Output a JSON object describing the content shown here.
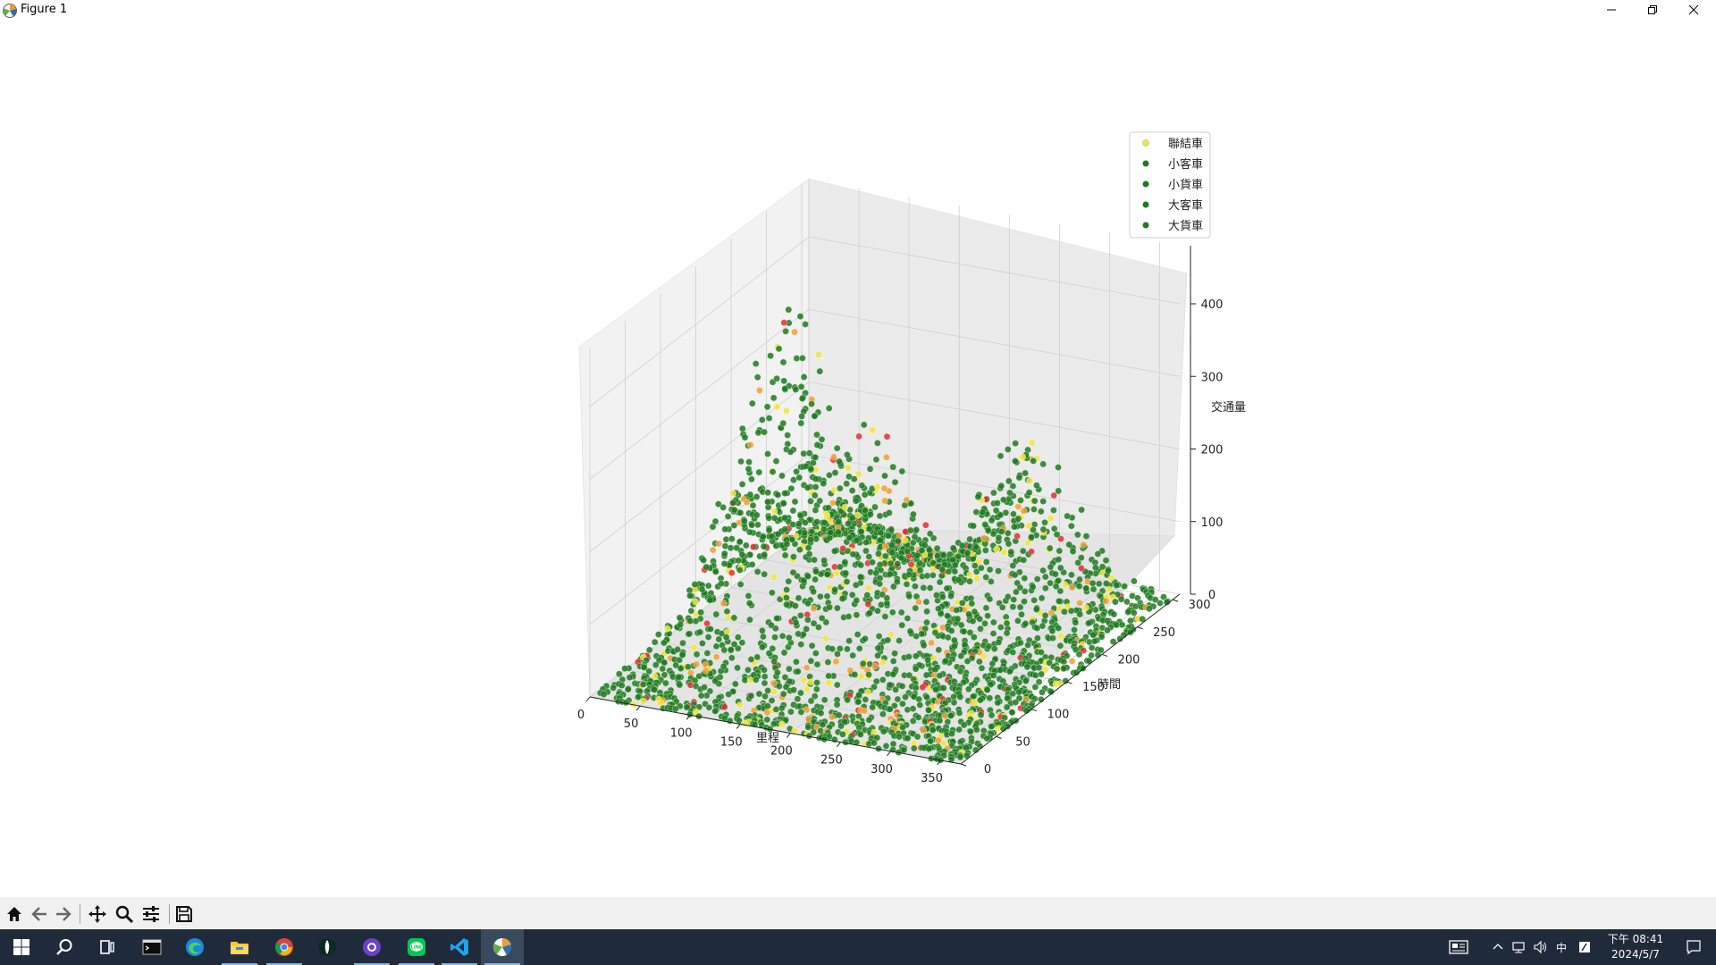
{
  "window": {
    "title": "Figure 1",
    "icons": {
      "app": "matplotlib-icon",
      "minimize": "minimize-icon",
      "restore": "restore-icon",
      "close": "close-icon"
    }
  },
  "chart_data": {
    "type": "scatter",
    "projection": "3d",
    "xlabel": "里程",
    "ylabel": "時間",
    "zlabel": "交通量",
    "xticks": [
      "0",
      "50",
      "100",
      "150",
      "200",
      "250",
      "300",
      "350"
    ],
    "yticks": [
      "0",
      "50",
      "100",
      "150",
      "200",
      "250",
      "300"
    ],
    "zticks": [
      "0",
      "100",
      "200",
      "300",
      "400"
    ],
    "xlim": [
      0,
      370
    ],
    "ylim": [
      0,
      310
    ],
    "zlim": [
      0,
      480
    ],
    "grid": true,
    "legend_position": "top-right",
    "series": [
      {
        "name": "聯結車",
        "color": "#f3e53a"
      },
      {
        "name": "小客車",
        "color": "#1f7a1f"
      },
      {
        "name": "小貨車",
        "color": "#1f7a1f"
      },
      {
        "name": "大客車",
        "color": "#1f7a1f"
      },
      {
        "name": "大貨車",
        "color": "#1f7a1f"
      }
    ],
    "accent_colors": {
      "orange": "#f0a030",
      "red": "#e03030"
    },
    "surface_peaks": [
      {
        "x": 70,
        "y": 180,
        "z": 450
      },
      {
        "x": 160,
        "y": 160,
        "z": 300
      },
      {
        "x": 240,
        "y": 270,
        "z": 220
      }
    ]
  },
  "toolbar": {
    "buttons": [
      {
        "name": "home-button",
        "icon": "home-icon"
      },
      {
        "name": "back-button",
        "icon": "arrow-left-icon"
      },
      {
        "name": "forward-button",
        "icon": "arrow-right-icon"
      },
      {
        "name": "pan-button",
        "icon": "move-icon"
      },
      {
        "name": "zoom-button",
        "icon": "magnifier-icon"
      },
      {
        "name": "configure-subplots-button",
        "icon": "sliders-icon"
      },
      {
        "name": "save-button",
        "icon": "floppy-icon"
      }
    ]
  },
  "taskbar": {
    "apps": [
      "start-icon",
      "search-icon",
      "task-view-icon",
      "terminal-icon",
      "edge-icon",
      "file-explorer-icon",
      "chrome-icon",
      "mongodb-compass-icon",
      "github-desktop-icon",
      "line-icon",
      "vscode-icon",
      "matplotlib-icon"
    ],
    "tray": {
      "ime": "中",
      "time": "下午 08:41",
      "date": "2024/5/7"
    }
  }
}
